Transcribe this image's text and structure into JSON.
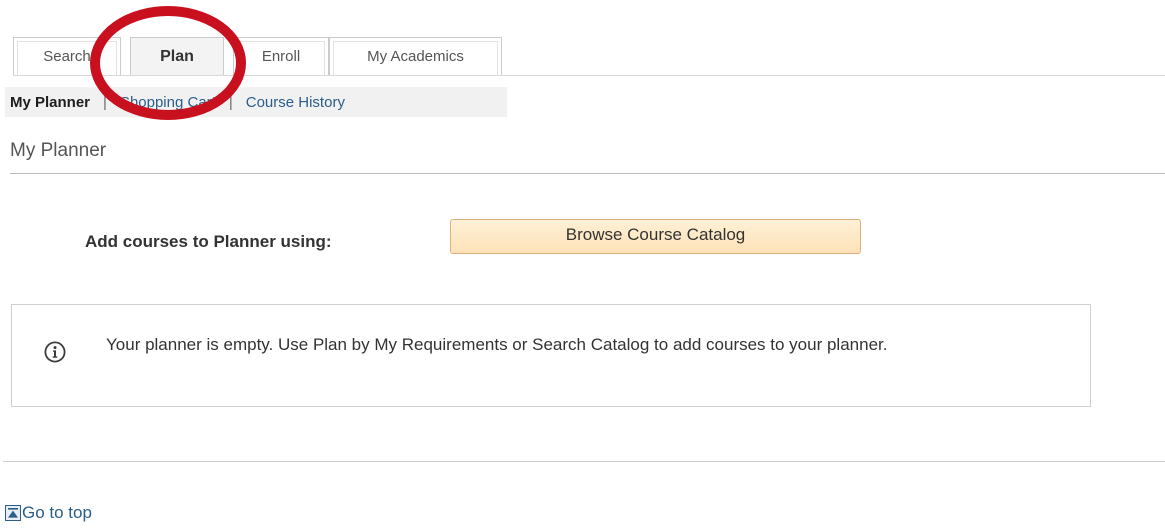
{
  "tabs": [
    {
      "label": "Search",
      "active": false
    },
    {
      "label": "Plan",
      "active": true
    },
    {
      "label": "Enroll",
      "active": false
    },
    {
      "label": "My Academics",
      "active": false
    }
  ],
  "subnav": {
    "items": [
      {
        "label": "My Planner",
        "current": true
      },
      {
        "label": "Shopping Cart",
        "current": false
      },
      {
        "label": "Course History",
        "current": false
      }
    ],
    "separator": "|"
  },
  "page": {
    "title": "My Planner",
    "add_label": "Add courses to Planner using:",
    "browse_button": "Browse Course Catalog",
    "info_message": "Your planner is empty.  Use Plan by My Requirements or Search Catalog to add courses to your planner."
  },
  "footer": {
    "go_top": "Go to top"
  },
  "icons": {
    "info": "info-icon",
    "go_top": "arrow-up-to-bar-icon"
  },
  "colors": {
    "annotation": "#c8101e",
    "link": "#2b5d8b",
    "button_fill": "#fde2b8",
    "button_border": "#d9b27a"
  }
}
